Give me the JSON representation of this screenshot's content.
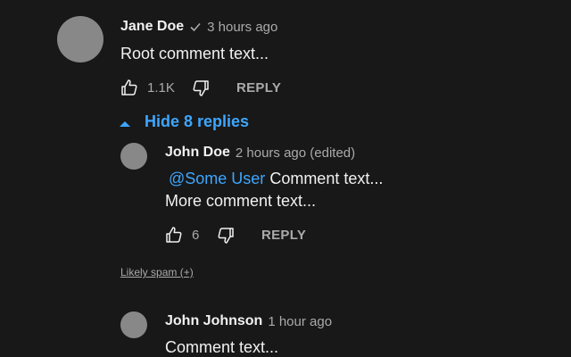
{
  "root_comment": {
    "author": "Jane Doe",
    "verified_icon": "check-icon",
    "timestamp": "3 hours ago",
    "text": "Root comment text...",
    "like_count": "1.1K",
    "reply_label": "REPLY"
  },
  "replies_toggle": {
    "icon": "caret-up-icon",
    "label": "Hide 8 replies"
  },
  "reply_1": {
    "author": "John Doe",
    "timestamp": "2 hours ago (edited)",
    "mention": "@Some User",
    "text_line1": " Comment text...",
    "text_line2": "More comment text...",
    "like_count": "6",
    "reply_label": "REPLY"
  },
  "spam_notice": {
    "label": "Likely spam (+)"
  },
  "reply_2": {
    "author": "John Johnson",
    "timestamp": "1 hour ago",
    "text": "Comment text..."
  },
  "colors": {
    "background": "#181818",
    "link_blue": "#3ea6ff",
    "avatar_gray": "#888888",
    "secondary_text": "#aaaaaa"
  }
}
